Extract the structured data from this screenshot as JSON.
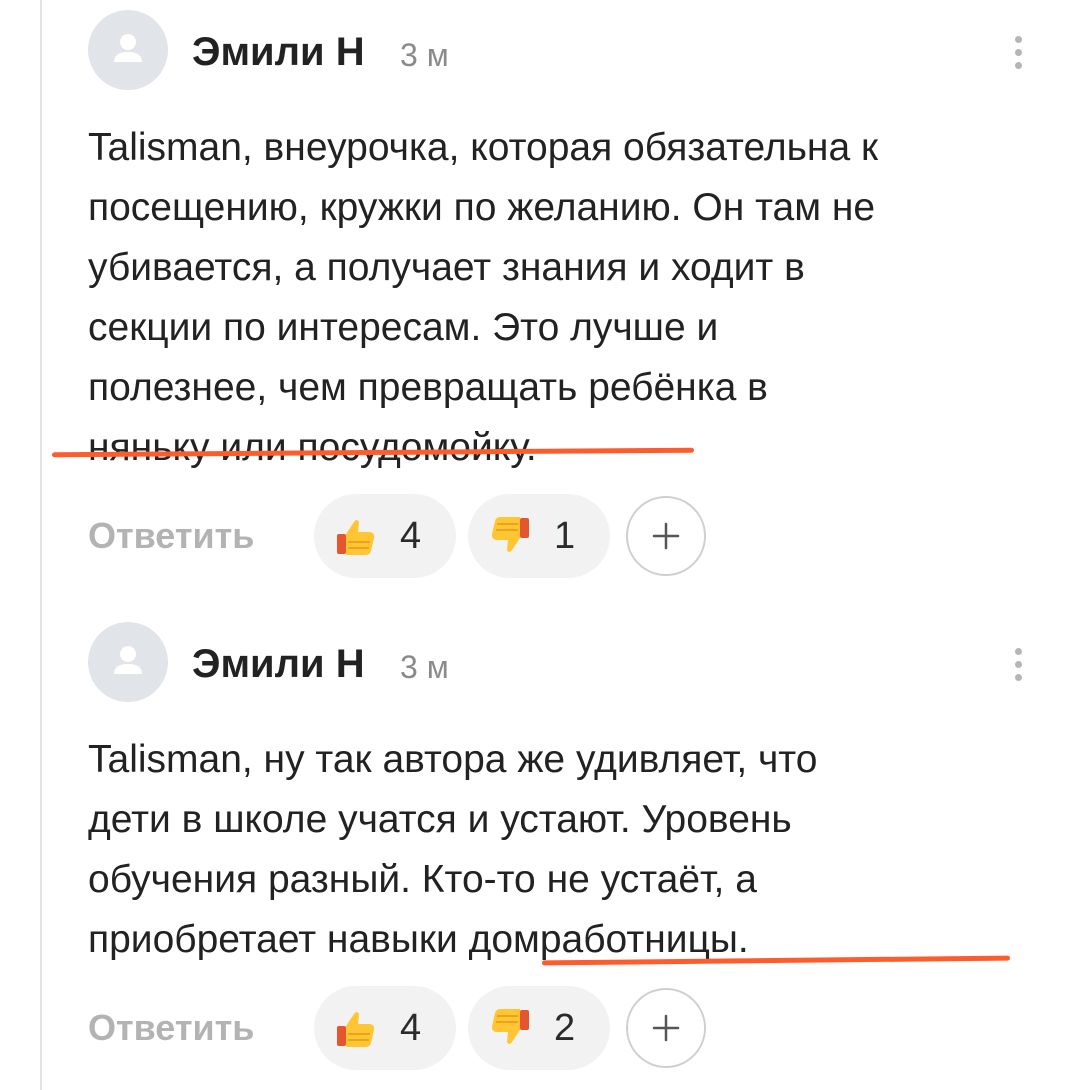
{
  "colors": {
    "accent_underline": "#ff5c2e",
    "avatar_bg": "#e1e4e9",
    "pill_bg": "#f2f2f2",
    "muted_text": "#b3b3b3"
  },
  "comments": [
    {
      "author": "Эмили Н",
      "time": "3 м",
      "text_lines": [
        "Talisman, внеурочка, которая обязательна к",
        "посещению, кружки по желанию. Он там не",
        "убивается, а получает знания и ходит в",
        "секции по интересам. Это лучше и",
        "полезнее, чем превращать ребёнка в",
        "няньку или посудомойку."
      ],
      "reply_label": "Ответить",
      "likes": "4",
      "dislikes": "1",
      "like_icon": "thumbs-up-icon",
      "dislike_icon": "thumbs-down-icon",
      "add_reaction_icon": "plus-icon",
      "menu_icon": "more-vertical-icon"
    },
    {
      "author": "Эмили Н",
      "time": "3 м",
      "text_lines": [
        "Talisman, ну так автора же удивляет, что",
        "дети в школе учатся и устают. Уровень",
        "обучения разный. Кто-то не устаёт, а",
        "приобретает навыки домработницы."
      ],
      "reply_label": "Ответить",
      "likes": "4",
      "dislikes": "2",
      "like_icon": "thumbs-up-icon",
      "dislike_icon": "thumbs-down-icon",
      "add_reaction_icon": "plus-icon",
      "menu_icon": "more-vertical-icon"
    }
  ]
}
